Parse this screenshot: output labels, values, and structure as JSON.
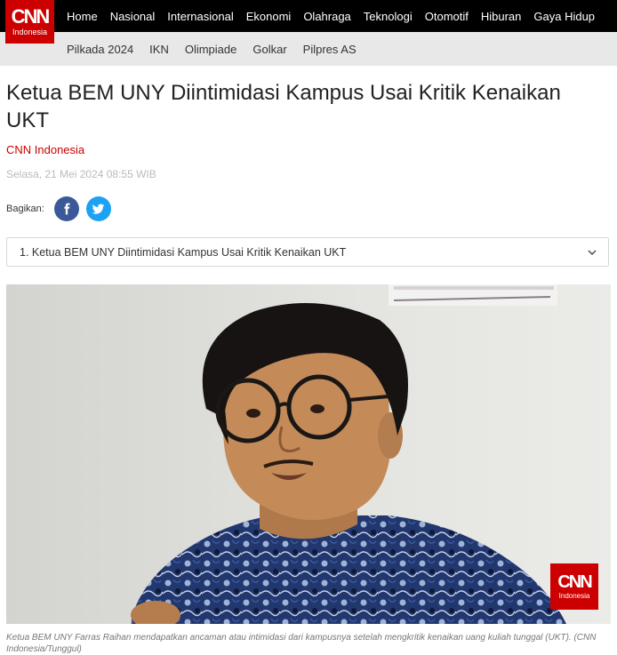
{
  "header": {
    "logo_text": "CNN",
    "logo_sub": "Indonesia",
    "nav": [
      "Home",
      "Nasional",
      "Internasional",
      "Ekonomi",
      "Olahraga",
      "Teknologi",
      "Otomotif",
      "Hiburan",
      "Gaya Hidup"
    ],
    "subnav": [
      "Pilkada 2024",
      "IKN",
      "Olimpiade",
      "Golkar",
      "Pilpres AS"
    ]
  },
  "article": {
    "title": "Ketua BEM UNY Diintimidasi Kampus Usai Kritik Kenaikan UKT",
    "source": "CNN Indonesia",
    "date": "Selasa, 21 Mei 2024 08:55 WIB",
    "share_label": "Bagikan:",
    "toc_item": "1. Ketua BEM UNY Diintimidasi Kampus Usai Kritik Kenaikan UKT",
    "watermark_text": "CNN",
    "watermark_sub": "Indonesia",
    "caption": "Ketua BEM UNY Farras Raihan mendapatkan ancaman atau intimidasi dari kampusnya setelah mengkritik kenaikan uang kuliah tunggal (UKT). (CNN Indonesia/Tunggul)"
  },
  "colors": {
    "brand": "#cc0000",
    "facebook": "#3b5998",
    "twitter": "#1da1f2"
  },
  "icons": {
    "share_1": "facebook-icon",
    "share_2": "twitter-icon",
    "toc": "chevron-down-icon"
  }
}
